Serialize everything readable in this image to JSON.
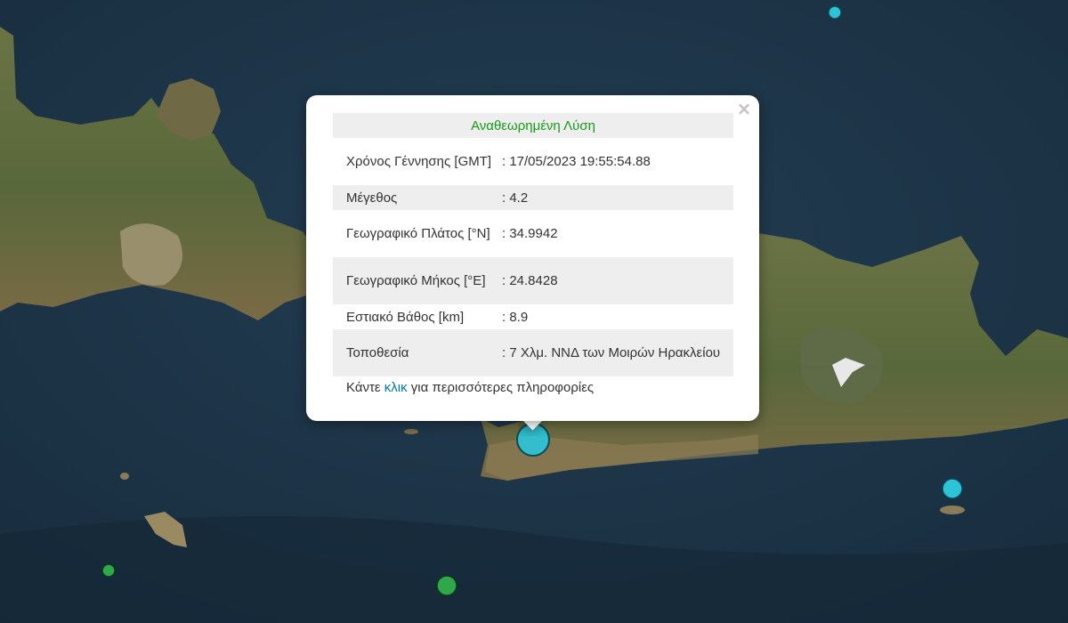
{
  "popup": {
    "title": "Αναθεωρημένη Λύση",
    "rows": [
      {
        "label": "Χρόνος Γέννησης [GMT]",
        "value": ": 17/05/2023 19:55:54.88"
      },
      {
        "label": "Μέγεθος",
        "value": ": 4.2"
      },
      {
        "label": "Γεωγραφικό Πλάτος [°N]",
        "value": ": 34.9942"
      },
      {
        "label": "Γεωγραφικό Μήκος [°E]",
        "value": ": 24.8428"
      },
      {
        "label": "Εστιακό Βάθος [km]",
        "value": ": 8.9"
      },
      {
        "label": "Τοποθεσία",
        "value": ": 7 Χλμ. ΝΝΔ των Μοιρών Ηρακλείου"
      }
    ],
    "footer_before": "Κάντε ",
    "footer_link": "κλικ",
    "footer_after": " για περισσότερες πληροφορίες",
    "close_glyph": "×"
  },
  "colors": {
    "sea": "#1d3447",
    "land": "#5b6b3d",
    "marker_cyan": "#2ec4d8",
    "marker_green": "#2ea84a",
    "title_green": "#159a15",
    "link_blue": "#0078a8"
  },
  "markers": [
    {
      "type": "selected-earthquake",
      "color": "cyan"
    },
    {
      "type": "earthquake",
      "color": "cyan"
    },
    {
      "type": "earthquake",
      "color": "cyan"
    },
    {
      "type": "earthquake",
      "color": "green"
    },
    {
      "type": "earthquake",
      "color": "green"
    }
  ]
}
